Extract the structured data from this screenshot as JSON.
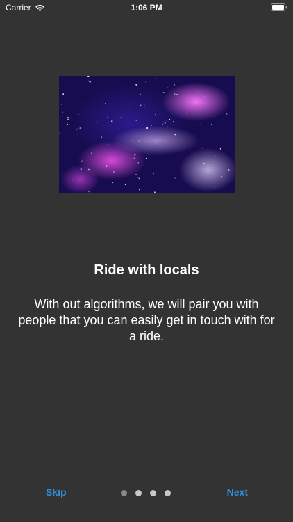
{
  "status_bar": {
    "carrier": "Carrier",
    "time": "1:06 PM",
    "wifi_icon": "wifi-icon",
    "battery_icon": "battery-icon"
  },
  "onboarding": {
    "image_alt": "galaxy-image",
    "title": "Ride with locals",
    "description": "With out algorithms, we will pair you with people that you can easily get in touch with for a ride."
  },
  "navigation": {
    "skip_label": "Skip",
    "next_label": "Next",
    "page_count": 4,
    "current_page": 1,
    "accent_color": "#2f8fd9"
  },
  "colors": {
    "background": "#333333",
    "text": "#ffffff"
  }
}
